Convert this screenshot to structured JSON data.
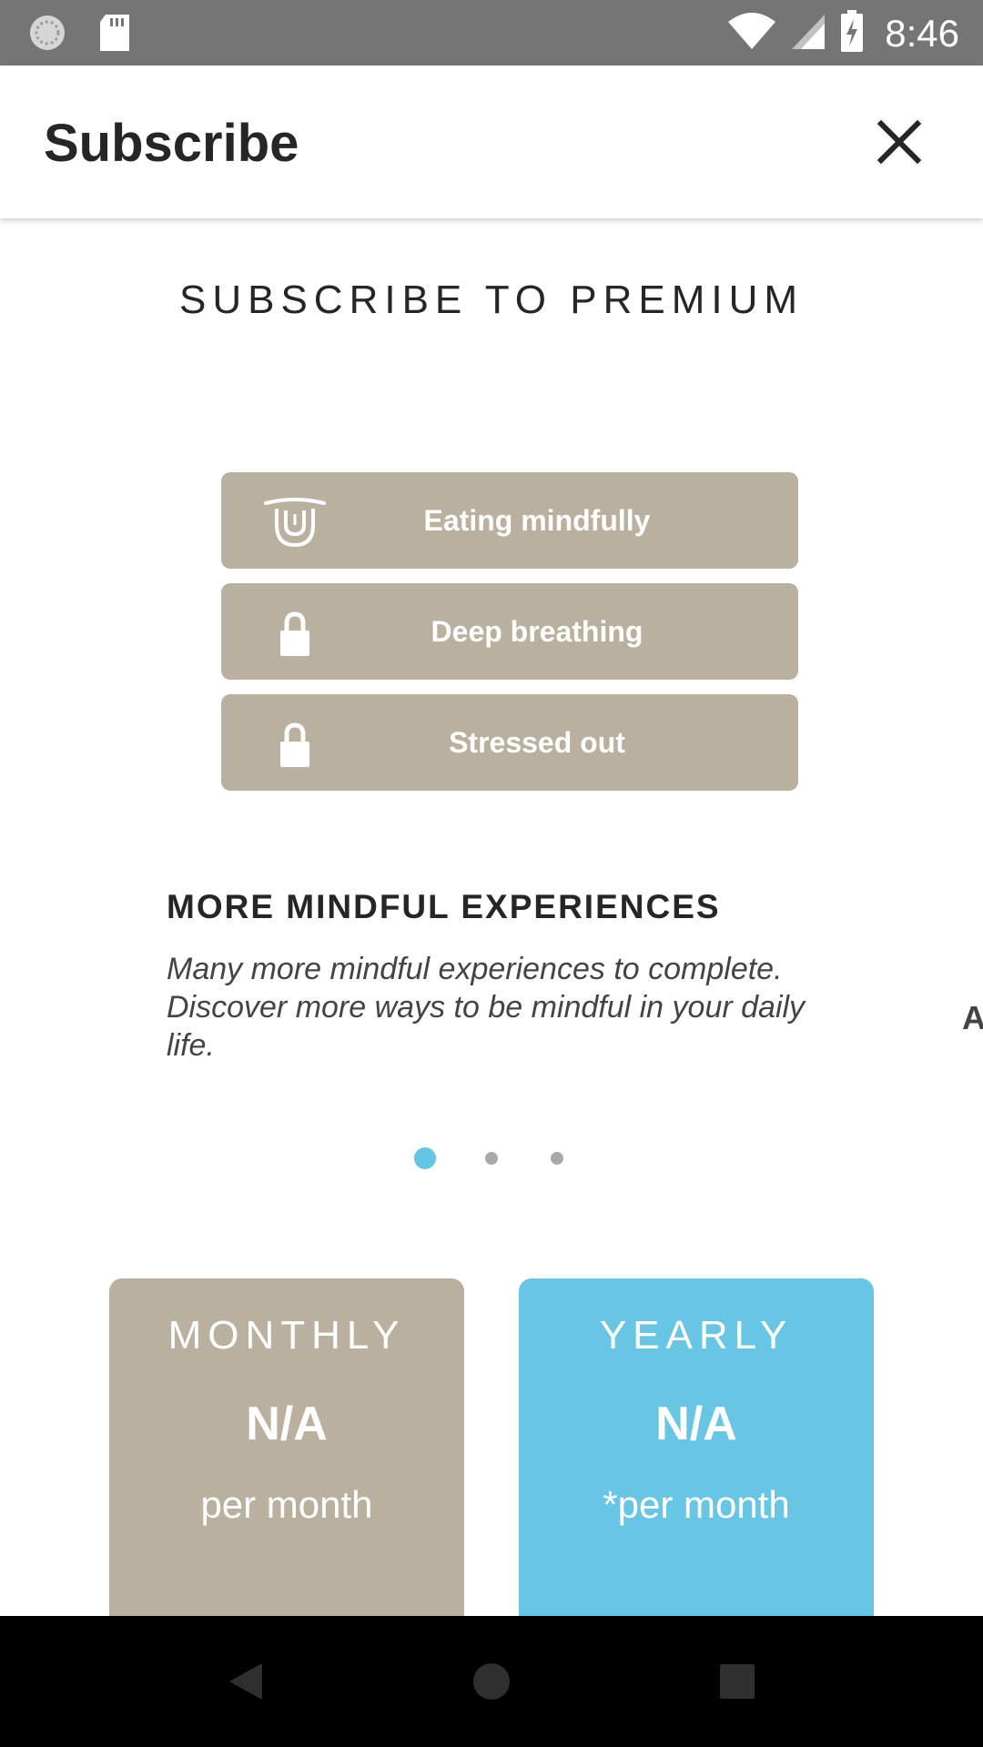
{
  "status_bar": {
    "time": "8:46",
    "left_icons": [
      "settings-sync-icon",
      "sd-card-icon"
    ],
    "right_icons": [
      "wifi-icon",
      "cell-signal-icon",
      "battery-charging-icon"
    ]
  },
  "app_bar": {
    "title": "Subscribe",
    "close_icon": "close-icon"
  },
  "heading": "SUBSCRIBE TO PREMIUM",
  "features": [
    {
      "label": "Eating mindfully",
      "icon": "tongue-face-icon",
      "locked": false
    },
    {
      "label": "Deep breathing",
      "icon": "lock-icon",
      "locked": true
    },
    {
      "label": "Stressed out",
      "icon": "lock-icon",
      "locked": true
    }
  ],
  "description": {
    "title": "MORE MINDFUL EXPERIENCES",
    "body": "Many more mindful experiences to complete. Discover more ways to be mindful in your daily life.",
    "next_slide_peek": "A"
  },
  "pager": {
    "count": 3,
    "active_index": 0,
    "active_color": "#67c5e4",
    "inactive_color": "#a9a9a9"
  },
  "plans": [
    {
      "name": "MONTHLY",
      "price": "N/A",
      "period": "per month",
      "color": "#bab09f"
    },
    {
      "name": "YEARLY",
      "price": "N/A",
      "period": "*per month",
      "color": "#68c5e4"
    }
  ],
  "nav_bar": {
    "back_icon": "back-triangle-icon",
    "home_icon": "home-circle-icon",
    "recents_icon": "recents-square-icon"
  },
  "colors": {
    "feature_bg": "#bab09f",
    "accent": "#67c5e4",
    "status_bar": "#757575"
  }
}
